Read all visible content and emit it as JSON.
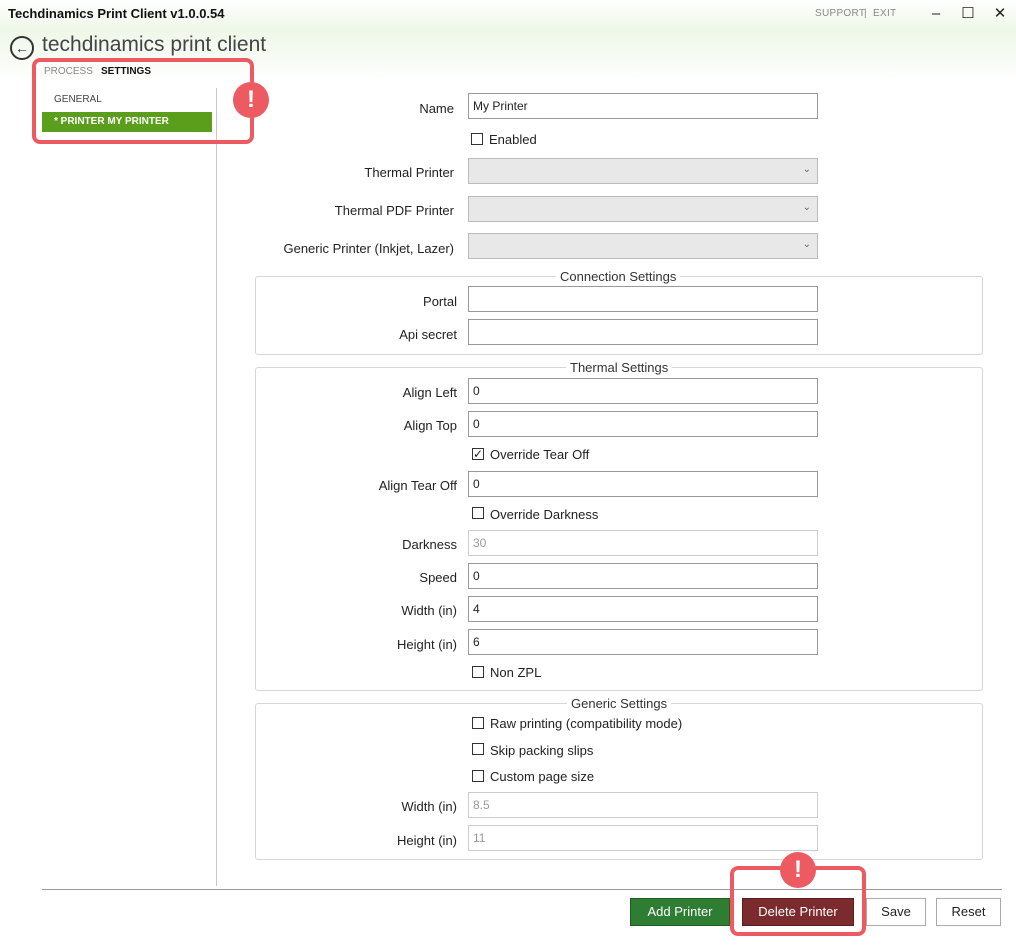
{
  "window": {
    "title": "Techdinamics Print Client v1.0.0.54",
    "support": "SUPPORT",
    "separator": "|",
    "exit": "EXIT",
    "minimize": "–",
    "maximize": "☐",
    "close": "✕"
  },
  "header": {
    "app_name": "techdinamics print client",
    "back_icon": "←"
  },
  "nav": {
    "tabs": [
      {
        "label": "PROCESS"
      },
      {
        "label": "SETTINGS",
        "active": true
      }
    ]
  },
  "sidebar": {
    "items": [
      {
        "label": "GENERAL"
      },
      {
        "label": "* PRINTER MY PRINTER",
        "selected": true
      }
    ]
  },
  "alert_badge": "!",
  "form": {
    "name": {
      "label": "Name",
      "value": "My Printer"
    },
    "enabled": {
      "label": "Enabled",
      "checked": false
    },
    "thermal_printer": {
      "label": "Thermal Printer",
      "value": ""
    },
    "thermal_pdf_printer": {
      "label": "Thermal PDF Printer",
      "value": ""
    },
    "generic_printer": {
      "label": "Generic Printer (Inkjet, Lazer)",
      "value": ""
    },
    "chevron": "⌄"
  },
  "connection": {
    "title": "Connection Settings",
    "portal": {
      "label": "Portal",
      "value": ""
    },
    "api_secret": {
      "label": "Api secret",
      "value": ""
    }
  },
  "thermal": {
    "title": "Thermal Settings",
    "align_left": {
      "label": "Align Left",
      "value": "0"
    },
    "align_top": {
      "label": "Align Top",
      "value": "0"
    },
    "override_tear_off": {
      "label": "Override Tear Off",
      "checked": true,
      "mark": "✓"
    },
    "align_tear_off": {
      "label": "Align Tear Off",
      "value": "0"
    },
    "override_darkness": {
      "label": "Override Darkness",
      "checked": false
    },
    "darkness": {
      "label": "Darkness",
      "value": "30"
    },
    "speed": {
      "label": "Speed",
      "value": "0"
    },
    "width": {
      "label": "Width (in)",
      "value": "4"
    },
    "height": {
      "label": "Height (in)",
      "value": "6"
    },
    "non_zpl": {
      "label": "Non ZPL",
      "checked": false
    }
  },
  "generic": {
    "title": "Generic Settings",
    "raw_printing": {
      "label": "Raw printing (compatibility mode)",
      "checked": false
    },
    "skip_packing_slips": {
      "label": "Skip packing slips",
      "checked": false
    },
    "custom_page_size": {
      "label": "Custom page size",
      "checked": false
    },
    "width": {
      "label": "Width (in)",
      "value": "8.5"
    },
    "height": {
      "label": "Height (in)",
      "value": "11"
    }
  },
  "footer": {
    "add_printer": "Add Printer",
    "delete_printer": "Delete Printer",
    "save": "Save",
    "reset": "Reset"
  },
  "colors": {
    "accent_green": "#5a9e1b",
    "add_button": "#2e7d32",
    "delete_button": "#7b2a2d",
    "alert": "#ee5a61"
  }
}
